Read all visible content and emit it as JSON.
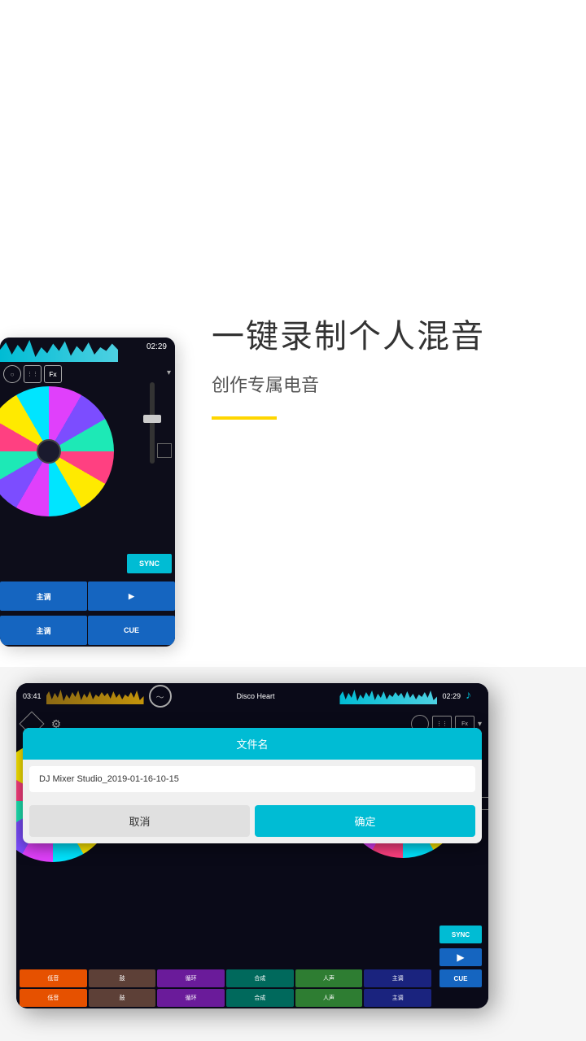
{
  "blobs": {
    "top_left_label": "decorative-blob-top-left",
    "top_right_label": "decorative-blob-top-right"
  },
  "top_section": {
    "main_title": "一键录制个人混音",
    "sub_title": "创作专属电音",
    "yellow_line": true
  },
  "tablet_top": {
    "time": "02:29",
    "sync_label": "SYNC",
    "row1_btn1": "主调",
    "row1_btn2": "▶",
    "row2_btn1": "主调",
    "row2_btn2": "CUE",
    "fx_label": "Fx",
    "eq_label": "⋮⋮"
  },
  "tablet_bottom": {
    "time_left": "03:41",
    "song_name": "Disco Heart",
    "time_right": "02:29",
    "dialog": {
      "title": "文件名",
      "input_value": "DJ Mixer Studio_2019-01-16-10-15",
      "cancel_label": "取消",
      "confirm_label": "确定"
    },
    "sync_label": "SYNC",
    "play_label": "▶",
    "cue_label": "CUE",
    "pad_rows": [
      [
        "低音",
        "鼓",
        "循环",
        "合成",
        "人声",
        "主调"
      ],
      [
        "低音",
        "鼓",
        "循环",
        "合成",
        "人声",
        "主调"
      ]
    ],
    "fx_label": "Fx",
    "eq_label": "⋮⋮"
  }
}
